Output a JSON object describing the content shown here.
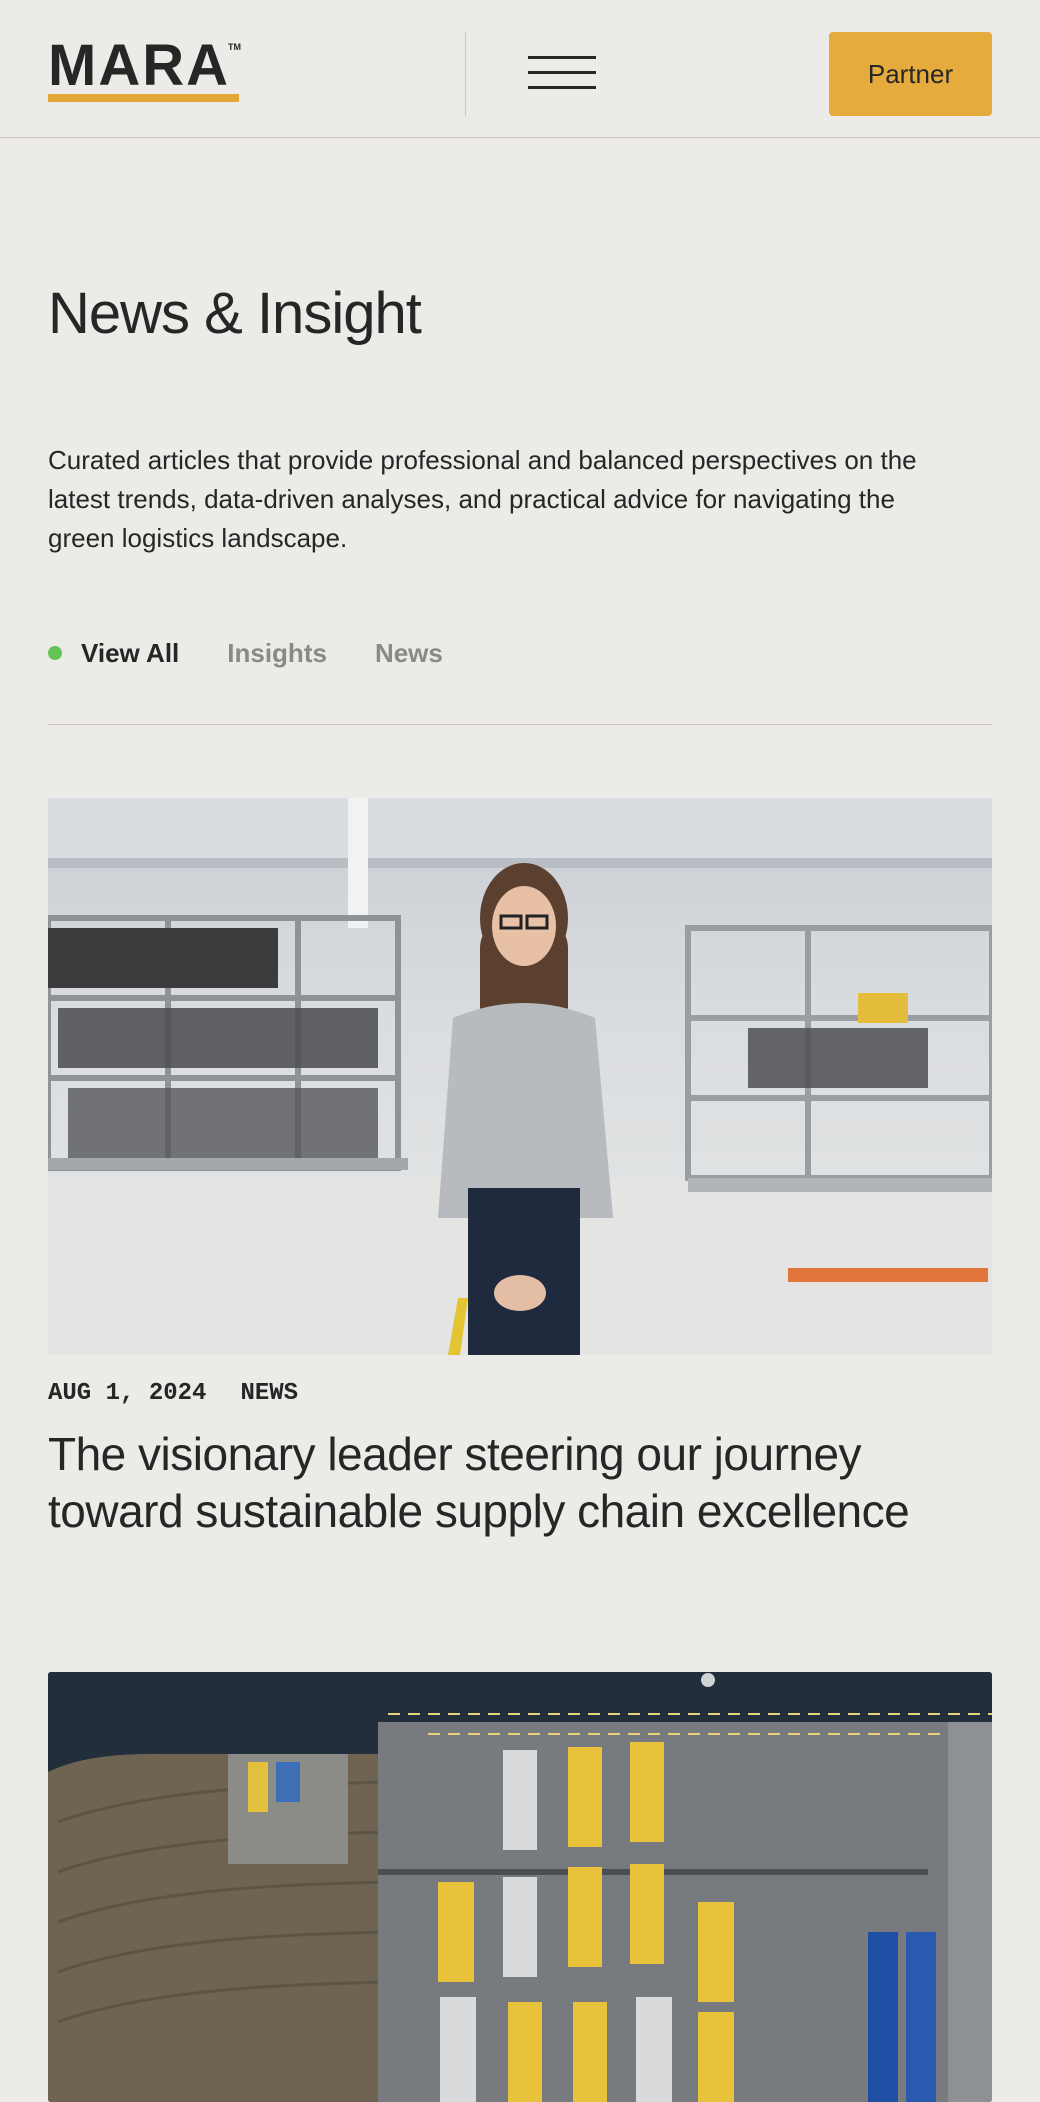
{
  "header": {
    "logo": "MARA",
    "logo_tm": "TM",
    "partner_label": "Partner"
  },
  "page": {
    "title": "News & Insight",
    "intro": "Curated articles that provide professional and balanced perspectives on the latest trends, data-driven analyses, and practical advice for navigating the green logistics landscape."
  },
  "filters": [
    {
      "label": "View All",
      "active": true
    },
    {
      "label": "Insights",
      "active": false
    },
    {
      "label": "News",
      "active": false
    }
  ],
  "articles": [
    {
      "date": "AUG 1, 2024",
      "category": "NEWS",
      "title": "The visionary leader steering our journey toward sustainable supply chain excellence"
    }
  ],
  "colors": {
    "background": "#edebe8",
    "accent": "#e5ab3d",
    "active_dot": "#61c454",
    "text": "#262626",
    "muted": "#8a8986"
  }
}
